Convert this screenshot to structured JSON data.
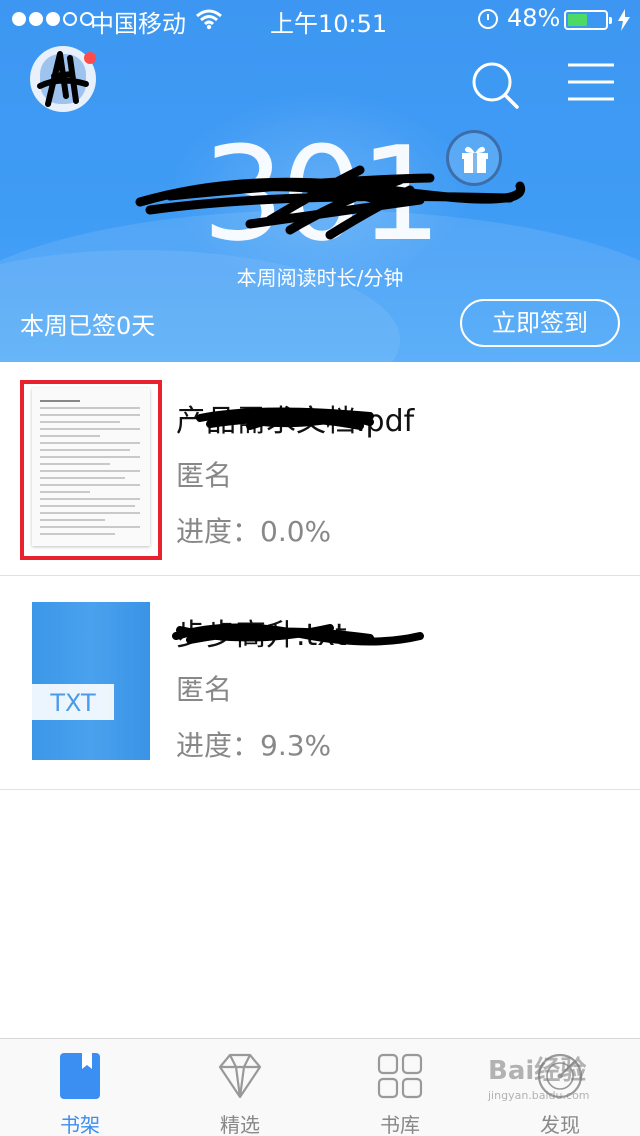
{
  "status_bar": {
    "carrier": "中国移动",
    "time": "上午10:51",
    "battery_percent": "48%",
    "battery_level": 0.48,
    "signal_bars": 3
  },
  "header": {
    "weekly_minutes": "301",
    "reading_label": "本周阅读时长/分钟",
    "signed_in_text": "本周已签0天",
    "checkin_button": "立即签到"
  },
  "books": [
    {
      "title": "产品需求文档.pdf",
      "author": "匿名",
      "progress": "进度：0.0%",
      "cover_type": "pdf"
    },
    {
      "title": "步步高升.txt",
      "author": "匿名",
      "progress": "进度：9.3%",
      "cover_type": "txt",
      "cover_label": "TXT"
    }
  ],
  "tabs": [
    {
      "label": "书架",
      "icon": "bookshelf-icon",
      "active": true
    },
    {
      "label": "精选",
      "icon": "diamond-icon",
      "active": false
    },
    {
      "label": "书库",
      "icon": "grid-icon",
      "active": false
    },
    {
      "label": "发现",
      "icon": "compass-icon",
      "active": false
    }
  ],
  "watermark": {
    "text": "Bai经验",
    "url_text": "jingyan.baidu.com"
  },
  "colors": {
    "header_blue": "#3d97f2",
    "accent_blue": "#3b8ef2",
    "highlight_red": "#e8232e",
    "battery_green": "#4cd964"
  }
}
